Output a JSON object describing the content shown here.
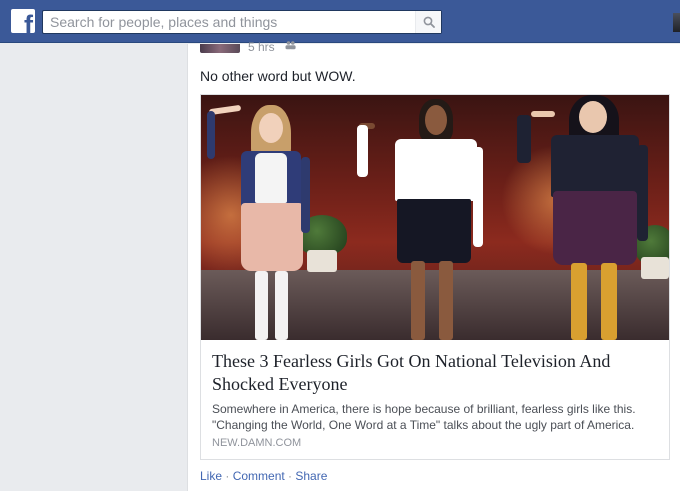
{
  "search": {
    "placeholder": "Search for people, places and things"
  },
  "post": {
    "meta_time": "5 hrs",
    "message": "No other word but WOW.",
    "link": {
      "title": "These 3 Fearless Girls Got On National Television And Shocked Everyone",
      "description": "Somewhere in America, there is hope because of brilliant, fearless girls like this. \"Changing the World, One Word at a Time\" talks about the ugly part of America.",
      "source": "NEW.DAMN.COM"
    },
    "actions": {
      "like": "Like",
      "comment": "Comment",
      "share": "Share",
      "separator": " · "
    }
  },
  "colors": {
    "topbar": "#3b5998",
    "link": "#4267b2",
    "page_bg": "#e9ebee"
  },
  "icons": {
    "logo": "facebook-f-icon",
    "search": "magnifier-icon",
    "audience": "friends-audience-icon"
  }
}
